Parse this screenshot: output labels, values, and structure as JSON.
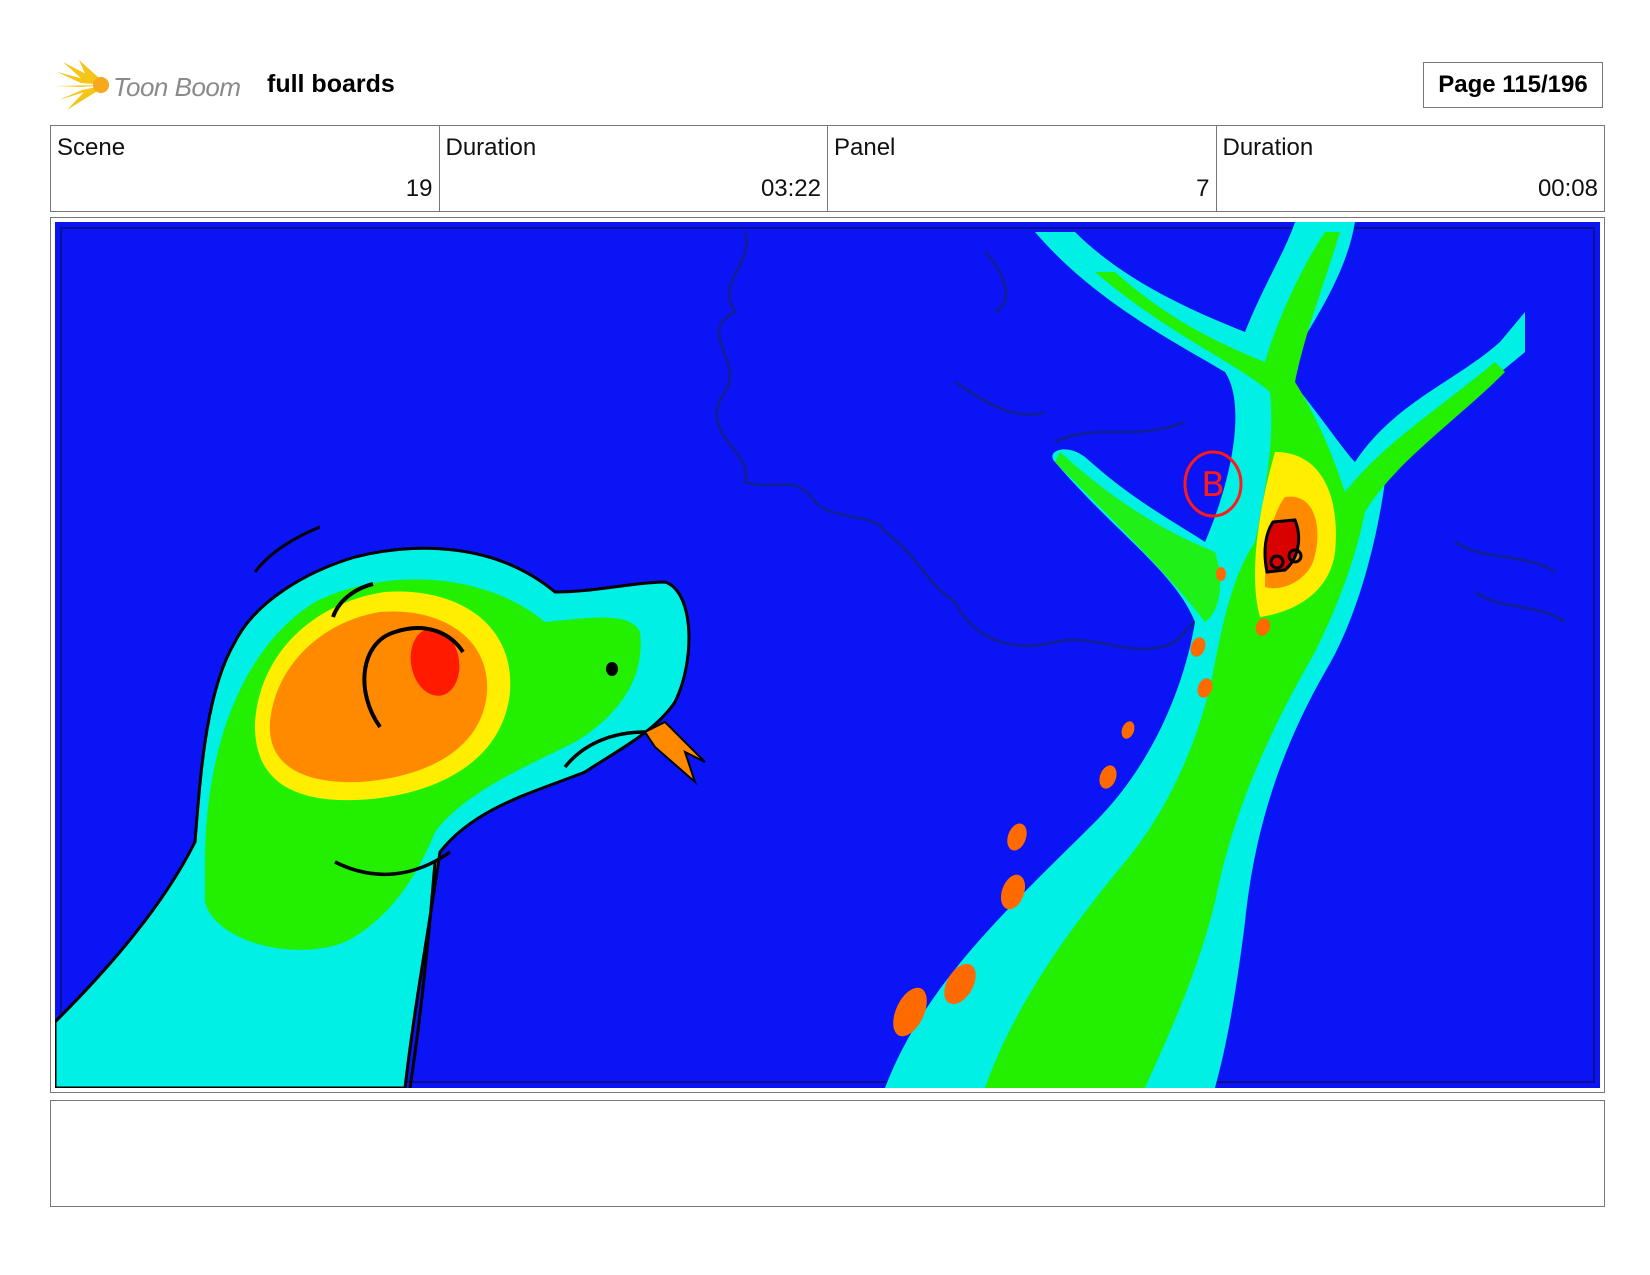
{
  "header": {
    "logo_text": "Toon Boom",
    "document_title": "full boards",
    "page_label": "Page 115/196"
  },
  "info": {
    "scene_label": "Scene",
    "scene_value": "19",
    "scene_duration_label": "Duration",
    "scene_duration_value": "03:22",
    "panel_label": "Panel",
    "panel_value": "7",
    "panel_duration_label": "Duration",
    "panel_duration_value": "00:08"
  },
  "panel": {
    "annotation_text": "B",
    "colors": {
      "background": "#0a14f5",
      "cyan": "#00f0e6",
      "green": "#22f000",
      "yellow": "#ffee00",
      "orange": "#ff8a00",
      "red": "#ff1a00"
    }
  },
  "caption": {
    "text": ""
  }
}
